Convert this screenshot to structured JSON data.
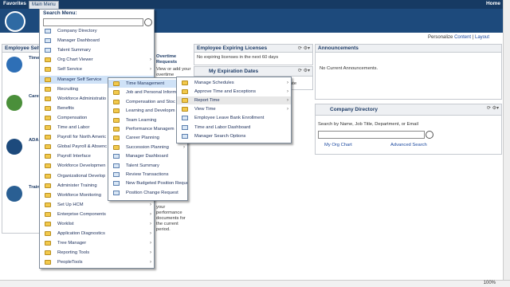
{
  "topbar": {
    "favorites": "Favorites",
    "main_menu": "Main Menu",
    "home": "Home"
  },
  "personalize": {
    "prefix": "Personalize",
    "content": "Content",
    "sep": "|",
    "layout": "Layout"
  },
  "left_pagelet": {
    "title": "Employee Self",
    "items": [
      {
        "title": "Time",
        "desc": "Report\nand t\na day\ntime p"
      },
      {
        "title": "Care",
        "desc": "Caree\njobs a\nyour d"
      },
      {
        "title": "ADA",
        "desc": "Acco\nReque\nADA\nAcco\nReque"
      },
      {
        "title": "Train",
        "desc": "Sumi\nView t\nyour t\ninform"
      }
    ]
  },
  "overtime": {
    "title": "Overtime Requests",
    "desc": "View or add your overtime"
  },
  "performance": {
    "desc": "your performance documents for the current period."
  },
  "expiring": {
    "title": "Employee Expiring Licenses",
    "body": "No expiring licenses in the next 60 days"
  },
  "expiration_dates": {
    "title": "My Expiration Dates",
    "note": "ate"
  },
  "announcements": {
    "title": "Announcements",
    "body": "No Current Announcements."
  },
  "company_directory": {
    "title": "Company Directory",
    "search_label": "Search by Name, Job Title, Department, or Email",
    "my_org_chart": "My Org Chart",
    "advanced_search": "Advanced Search"
  },
  "search_menu": {
    "label": "Search Menu:",
    "items": [
      {
        "label": "Company Directory",
        "type": "doc"
      },
      {
        "label": "Manager Dashboard",
        "type": "doc"
      },
      {
        "label": "Talent Summary",
        "type": "doc"
      },
      {
        "label": "Org Chart Viewer",
        "type": "folder",
        "arrow": true
      },
      {
        "label": "Self Service",
        "type": "folder",
        "arrow": true
      },
      {
        "label": "Manager Self Service",
        "type": "folder",
        "arrow": true
      },
      {
        "label": "Recruiting",
        "type": "folder",
        "arrow": true
      },
      {
        "label": "Workforce Administratio",
        "type": "folder",
        "arrow": true
      },
      {
        "label": "Benefits",
        "type": "folder",
        "arrow": true
      },
      {
        "label": "Compensation",
        "type": "folder",
        "arrow": true
      },
      {
        "label": "Time and Labor",
        "type": "folder",
        "arrow": true
      },
      {
        "label": "Payroll for North Americ",
        "type": "folder",
        "arrow": true
      },
      {
        "label": "Global Payroll & Absenc",
        "type": "folder",
        "arrow": true
      },
      {
        "label": "Payroll Interface",
        "type": "folder",
        "arrow": true
      },
      {
        "label": "Workforce Developmen",
        "type": "folder",
        "arrow": true
      },
      {
        "label": "Organizational Develop",
        "type": "folder",
        "arrow": true
      },
      {
        "label": "Administer Training",
        "type": "folder",
        "arrow": true
      },
      {
        "label": "Workforce Monitoring",
        "type": "folder",
        "arrow": true
      },
      {
        "label": "Set Up HCM",
        "type": "folder",
        "arrow": true
      },
      {
        "label": "Enterprise Components",
        "type": "folder",
        "arrow": true
      },
      {
        "label": "Worklist",
        "type": "folder",
        "arrow": true
      },
      {
        "label": "Application Diagnostics",
        "type": "folder",
        "arrow": true
      },
      {
        "label": "Tree Manager",
        "type": "folder",
        "arrow": true
      },
      {
        "label": "Reporting Tools",
        "type": "folder",
        "arrow": true
      },
      {
        "label": "PeopleTools",
        "type": "folder",
        "arrow": true
      }
    ]
  },
  "mss_menu": {
    "items": [
      {
        "label": "Time Management",
        "type": "folder",
        "arrow": true
      },
      {
        "label": "Job and Personal Inform",
        "type": "folder",
        "arrow": true
      },
      {
        "label": "Compensation and Stoc",
        "type": "folder",
        "arrow": true
      },
      {
        "label": "Learning and Developm",
        "type": "folder",
        "arrow": true
      },
      {
        "label": "Team Learning",
        "type": "folder",
        "arrow": true
      },
      {
        "label": "Performance Managem",
        "type": "folder",
        "arrow": true
      },
      {
        "label": "Career Planning",
        "type": "folder",
        "arrow": true
      },
      {
        "label": "Succession Planning",
        "type": "folder",
        "arrow": true
      },
      {
        "label": "Manager Dashboard",
        "type": "doc"
      },
      {
        "label": "Talent Summary",
        "type": "doc"
      },
      {
        "label": "Review Transactions",
        "type": "doc"
      },
      {
        "label": "New Budgeted Position Request",
        "type": "doc"
      },
      {
        "label": "Position Change Request",
        "type": "doc"
      }
    ]
  },
  "time_menu": {
    "items": [
      {
        "label": "Manage Schedules",
        "type": "folder",
        "arrow": true
      },
      {
        "label": "Approve Time and Exceptions",
        "type": "folder",
        "arrow": true
      },
      {
        "label": "Report Time",
        "type": "folder",
        "arrow": true
      },
      {
        "label": "View Time",
        "type": "folder",
        "arrow": true
      },
      {
        "label": "Employee Leave Bank Enrollment",
        "type": "doc"
      },
      {
        "label": "Time and Labor Dashboard",
        "type": "doc"
      },
      {
        "label": "Manager Search Options",
        "type": "doc"
      }
    ]
  },
  "status": {
    "zoom": "100%"
  }
}
